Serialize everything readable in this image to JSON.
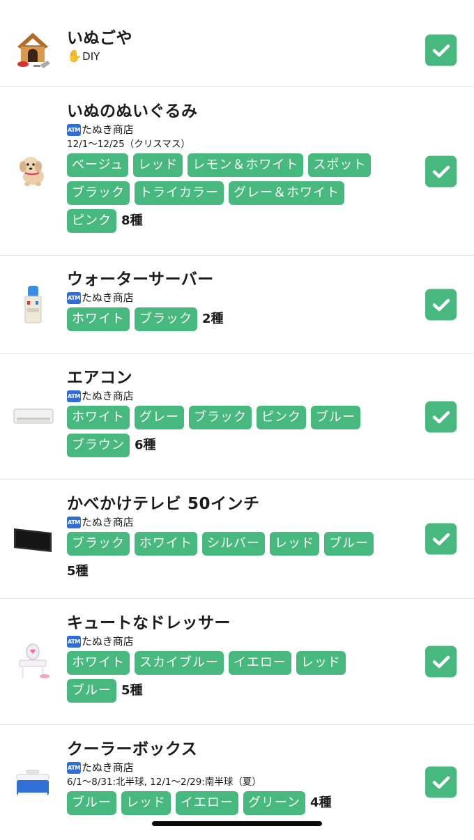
{
  "icons": {
    "check": "checkmark-icon",
    "diy": "raised-hand-icon",
    "shop": "atm-icon"
  },
  "colors": {
    "chip": "#48b97e",
    "check": "#48b97e",
    "atm": "#2f6dd8"
  },
  "atm_label": "ATM",
  "items": [
    {
      "id": "dog-house",
      "name": "いぬごや",
      "source": "DIY",
      "source_icon": "raised-hand-icon",
      "checked": true
    },
    {
      "id": "plush-dog",
      "name": "いぬのぬいぐるみ",
      "source": "たぬき商店",
      "source_icon": "atm-icon",
      "period": "12/1〜12/25（クリスマス）",
      "variants": [
        "ベージュ",
        "レッド",
        "レモン＆ホワイト",
        "スポット",
        "ブラック",
        "トライカラー",
        "グレー＆ホワイト",
        "ピンク"
      ],
      "count": "8種",
      "checked": true
    },
    {
      "id": "water-cooler",
      "name": "ウォーターサーバー",
      "source": "たぬき商店",
      "source_icon": "atm-icon",
      "variants": [
        "ホワイト",
        "ブラック"
      ],
      "count": "2種",
      "checked": true
    },
    {
      "id": "air-conditioner",
      "name": "エアコン",
      "source": "たぬき商店",
      "source_icon": "atm-icon",
      "variants": [
        "ホワイト",
        "グレー",
        "ブラック",
        "ピンク",
        "ブルー",
        "ブラウン"
      ],
      "count": "6種",
      "checked": true
    },
    {
      "id": "wall-tv",
      "name": "かべかけテレビ 50インチ",
      "source": "たぬき商店",
      "source_icon": "atm-icon",
      "variants": [
        "ブラック",
        "ホワイト",
        "シルバー",
        "レッド",
        "ブルー"
      ],
      "count": "5種",
      "checked": true
    },
    {
      "id": "cute-dresser",
      "name": "キュートなドレッサー",
      "source": "たぬき商店",
      "source_icon": "atm-icon",
      "variants": [
        "ホワイト",
        "スカイブルー",
        "イエロー",
        "レッド",
        "ブルー"
      ],
      "count": "5種",
      "checked": true
    },
    {
      "id": "cooler-box",
      "name": "クーラーボックス",
      "source": "たぬき商店",
      "source_icon": "atm-icon",
      "period": "6/1〜8/31:北半球, 12/1〜2/29:南半球（夏）",
      "variants": [
        "ブルー",
        "レッド",
        "イエロー",
        "グリーン"
      ],
      "count": "4種",
      "checked": true
    }
  ]
}
